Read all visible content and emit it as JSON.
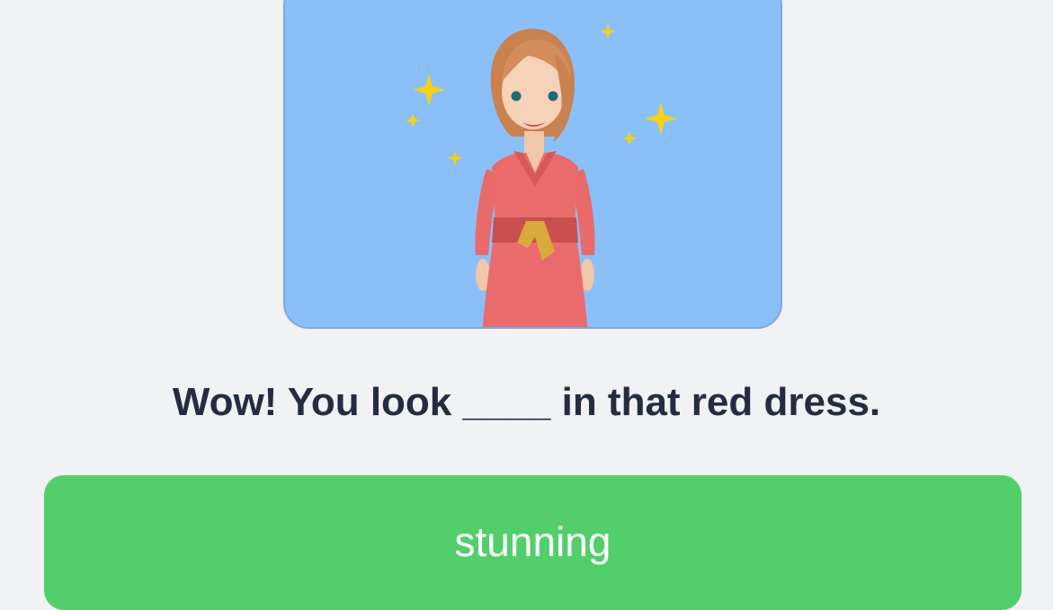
{
  "question": {
    "text": "Wow! You look ____ in that red dress."
  },
  "illustration": {
    "icon": "woman-in-red-dress-illustration",
    "background": "#8bbff7"
  },
  "answer_option": {
    "label": "stunning",
    "color": "#52cf6a"
  }
}
